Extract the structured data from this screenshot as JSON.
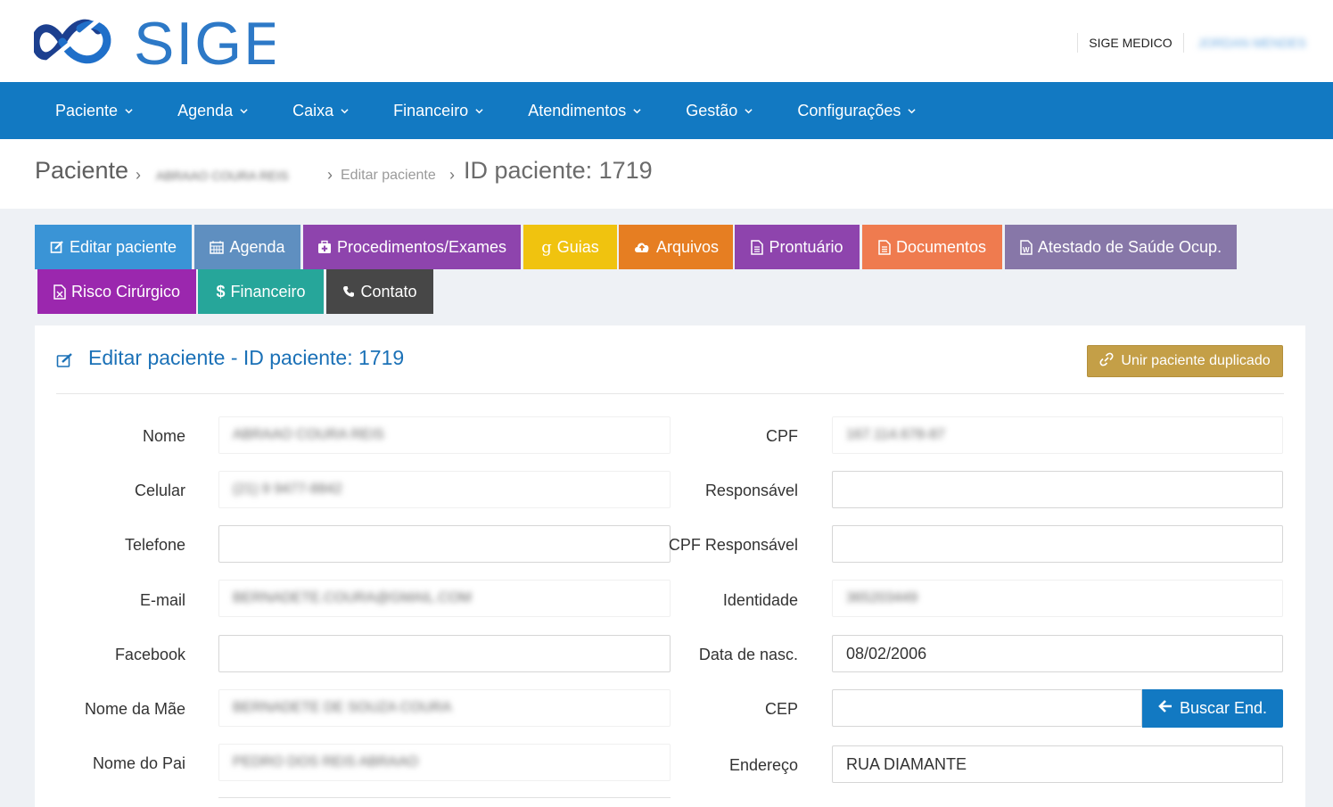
{
  "brand": {
    "logo_text": "SIGE"
  },
  "header": {
    "clinic": "SIGE MEDICO",
    "user_name": "JORDAN MENDES"
  },
  "nav": [
    {
      "label": "Paciente"
    },
    {
      "label": "Agenda"
    },
    {
      "label": "Caixa"
    },
    {
      "label": "Financeiro"
    },
    {
      "label": "Atendimentos"
    },
    {
      "label": "Gestão"
    },
    {
      "label": "Configurações"
    }
  ],
  "breadcrumb": {
    "root": "Paciente",
    "patient": "ABRAAO COURA REIS",
    "edit": "Editar paciente",
    "id_label": "ID paciente: 1719"
  },
  "tabs": [
    {
      "label": "Editar paciente",
      "color": "#3a94d6",
      "icon": "edit-icon"
    },
    {
      "label": "Agenda",
      "color": "#5f8fc0",
      "icon": "calendar-icon"
    },
    {
      "label": "Procedimentos/Exames",
      "color": "#8e44ad",
      "icon": "medkit-icon"
    },
    {
      "label": "Guias",
      "color": "#f0c30f",
      "icon": "google-icon"
    },
    {
      "label": "Arquivos",
      "color": "#e67e22",
      "icon": "cloud-upload-icon"
    },
    {
      "label": "Prontuário",
      "color": "#8e44ad",
      "icon": "file-text-icon"
    },
    {
      "label": "Documentos",
      "color": "#ef7b4f",
      "icon": "file-text-icon"
    },
    {
      "label": "Atestado de Saúde Ocup.",
      "color": "#8777a8",
      "icon": "file-word-icon"
    },
    {
      "label": "Risco Cirúrgico",
      "color": "#9b27ae",
      "icon": "file-excel-icon"
    },
    {
      "label": "Financeiro",
      "color": "#26a69a",
      "icon": "dollar-icon"
    },
    {
      "label": "Contato",
      "color": "#474747",
      "icon": "phone-icon"
    }
  ],
  "panel": {
    "title": "Editar paciente - ID paciente: 1719",
    "duplicate_button": "Unir paciente duplicado"
  },
  "form": {
    "left": [
      {
        "label": "Nome",
        "value": "ABRAAO COURA REIS",
        "blurred": true
      },
      {
        "label": "Celular",
        "value": "(21) 9 9477-8842",
        "blurred": true
      },
      {
        "label": "Telefone",
        "value": "",
        "blurred": false
      },
      {
        "label": "E-mail",
        "value": "BERNADETE.COURA@GMAIL.COM",
        "blurred": true
      },
      {
        "label": "Facebook",
        "value": "",
        "blurred": false
      },
      {
        "label": "Nome da Mãe",
        "value": "BERNADETE DE SOUZA COURA",
        "blurred": true
      },
      {
        "label": "Nome do Pai",
        "value": "PEDRO DOS REIS ABRAAO",
        "blurred": true
      }
    ],
    "right": [
      {
        "label": "CPF",
        "value": "167.114.678-87",
        "blurred": true
      },
      {
        "label": "Responsável",
        "value": "",
        "blurred": false
      },
      {
        "label": "CPF Responsável",
        "value": "",
        "blurred": false
      },
      {
        "label": "Identidade",
        "value": "365203449",
        "blurred": true
      },
      {
        "label": "Data de nasc.",
        "value": "08/02/2006",
        "blurred": false
      },
      {
        "label": "CEP",
        "value": "",
        "blurred": false
      },
      {
        "label": "Endereço",
        "value": "RUA DIAMANTE",
        "blurred": false
      }
    ],
    "cep_button": "Buscar End."
  }
}
